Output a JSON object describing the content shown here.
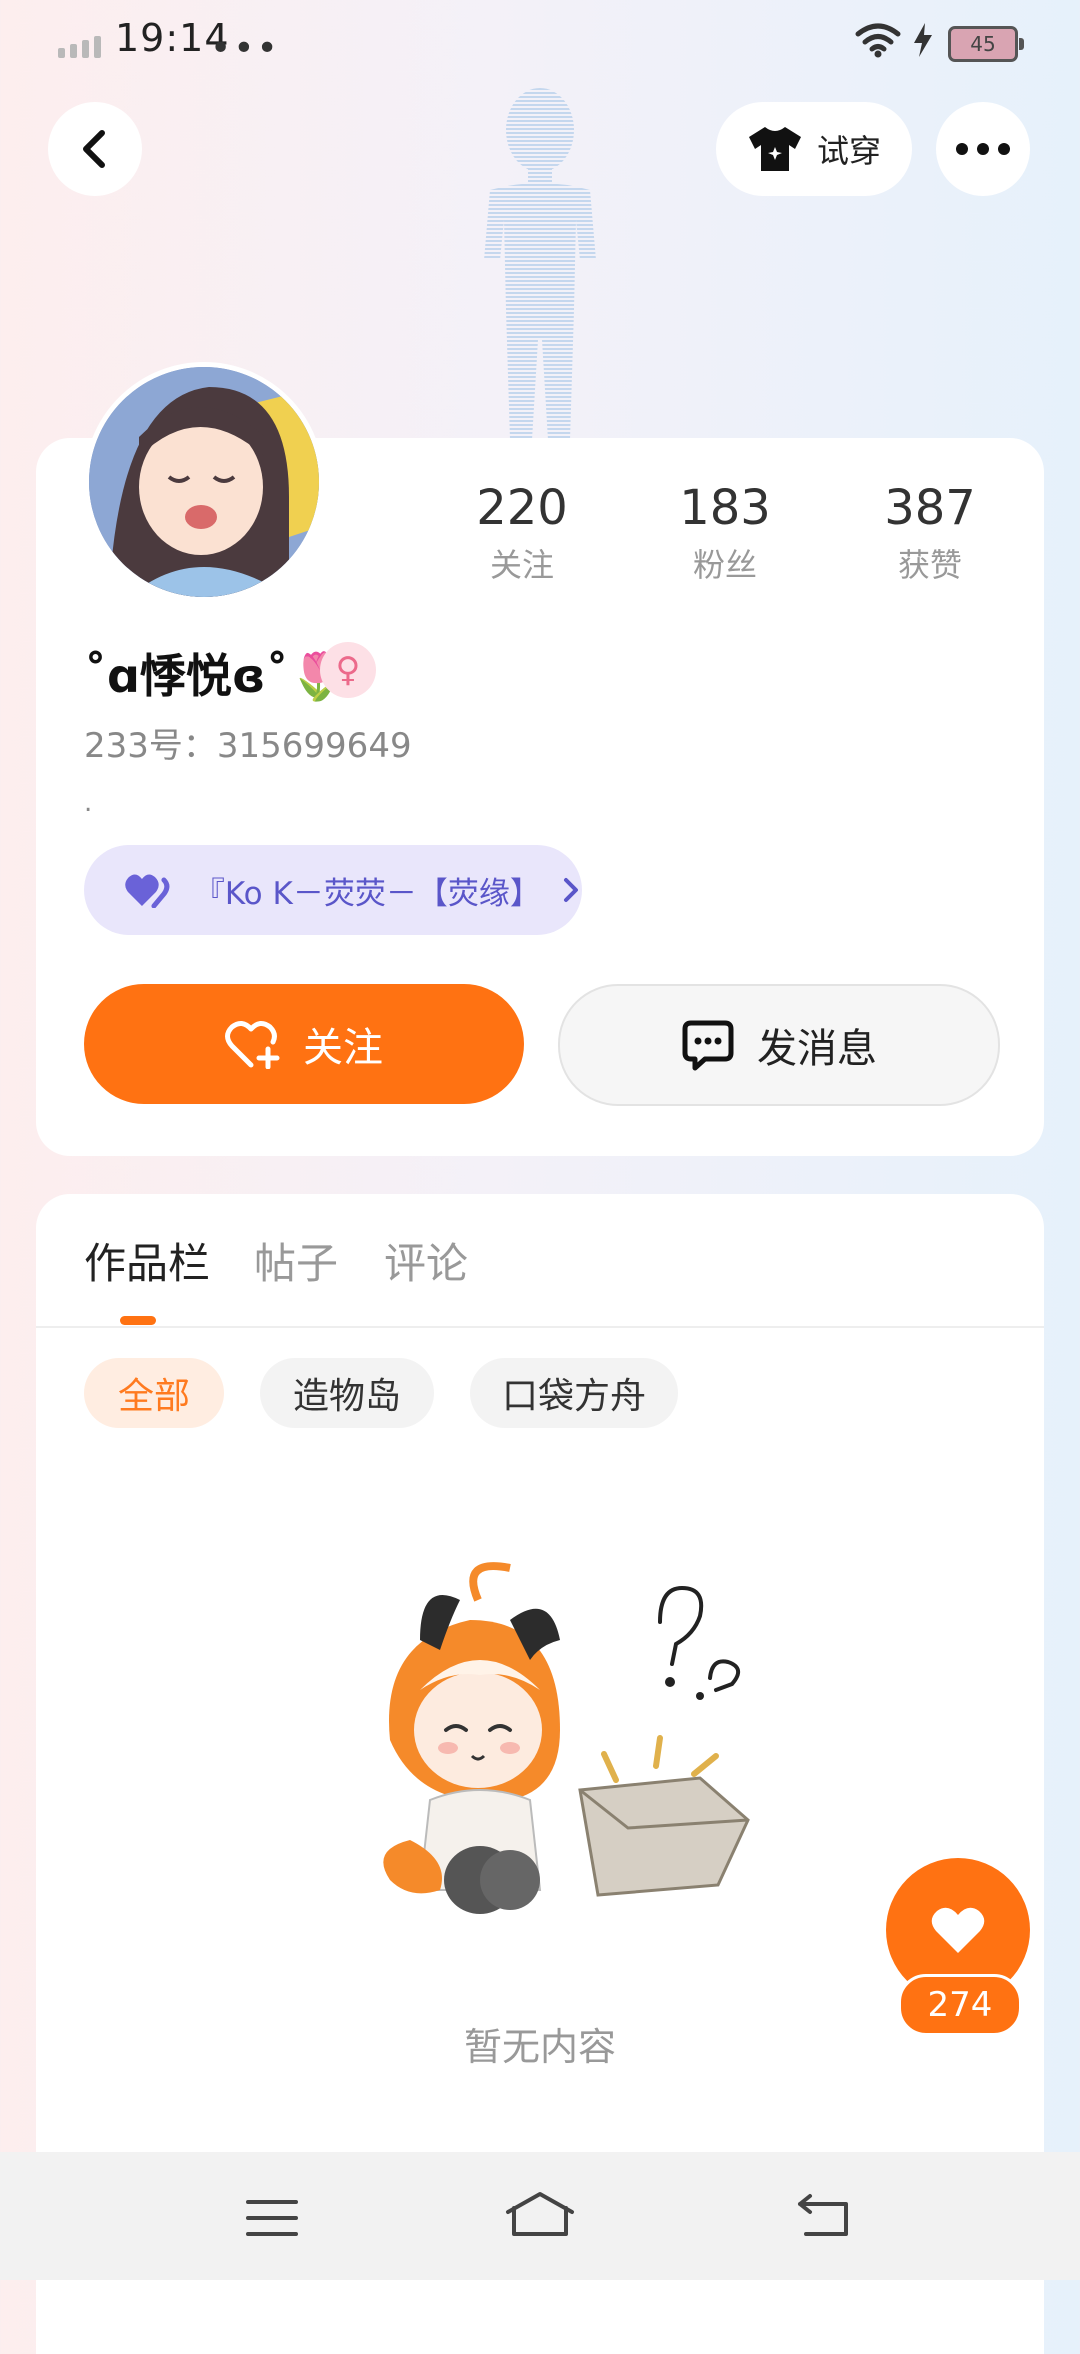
{
  "status_bar": {
    "time": "19:14",
    "more_dots": "•••",
    "battery": "45"
  },
  "header": {
    "try_on_label": "试穿"
  },
  "profile": {
    "stats": [
      {
        "value": "220",
        "label": "关注"
      },
      {
        "value": "183",
        "label": "粉丝"
      },
      {
        "value": "387",
        "label": "获赞"
      }
    ],
    "nickname": "˚ɑ悸悦ɞ˚🌷",
    "gender_symbol": "♀",
    "id_text": "233号：315699649",
    "bio": ".",
    "cp_label": "『Ko  K－荧荧－【荧缘】",
    "follow_label": "关注",
    "message_label": "发消息"
  },
  "tabs": [
    {
      "label": "作品栏",
      "active": true
    },
    {
      "label": "帖子",
      "active": false
    },
    {
      "label": "评论",
      "active": false
    }
  ],
  "filters": [
    {
      "label": "全部",
      "selected": true
    },
    {
      "label": "造物岛",
      "selected": false
    },
    {
      "label": "口袋方舟",
      "selected": false
    }
  ],
  "empty_state": {
    "text": "暂无内容"
  },
  "like_button": {
    "count": "274"
  },
  "colors": {
    "accent": "#ff7212",
    "cp_text": "#5a56c9"
  },
  "icons": [
    "back-icon",
    "shirt-icon",
    "more-icon",
    "heart-plus-icon",
    "chat-icon",
    "heart-icon",
    "menu-icon",
    "home-icon",
    "back-arrow-icon"
  ]
}
